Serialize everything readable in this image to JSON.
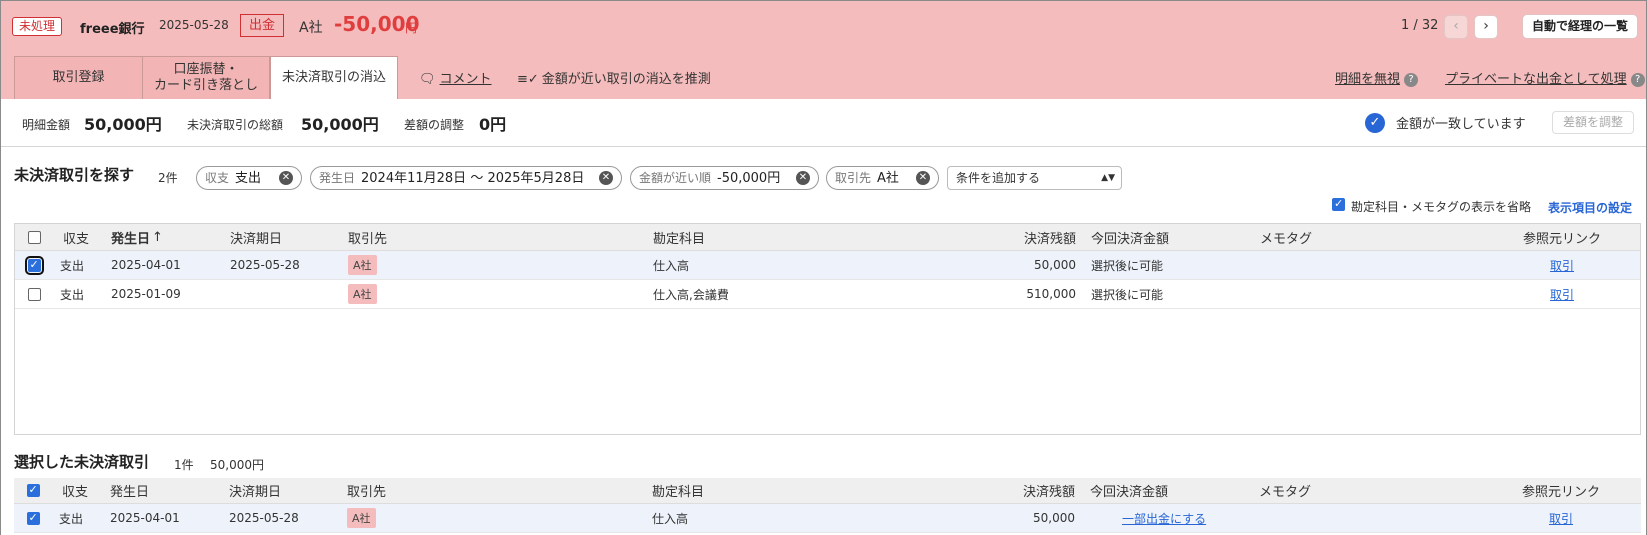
{
  "header": {
    "status_badge": "未処理",
    "bank": "freee銀行",
    "date": "2025-05-28",
    "type_badge": "出金",
    "partner": "A社",
    "amount": "-50,000",
    "amount_unit": "円",
    "pager": "1 / 32",
    "auto_button": "自動で経理の一覧",
    "accent": "#f4bcbc"
  },
  "tabs": [
    {
      "label": "取引登録"
    },
    {
      "label": "口座振替・\nカード引き落とし"
    },
    {
      "label": "未決済取引の消込"
    }
  ],
  "header_links": {
    "comment": "コメント",
    "suggest": "金額が近い取引の消込を推測",
    "ignore": "明細を無視",
    "private": "プライベートな出金として処理"
  },
  "summary": {
    "detail_label": "明細金額",
    "detail_value": "50,000円",
    "total_label": "未決済取引の総額",
    "total_value": "50,000円",
    "diff_label": "差額の調整",
    "diff_value": "0円",
    "match_text": "金額が一致しています",
    "adjust_button": "差額を調整"
  },
  "search": {
    "title": "未決済取引を探す",
    "count": "2件",
    "chips": [
      {
        "key": "収支",
        "value": "支出"
      },
      {
        "key": "発生日",
        "value": "2024年11月28日 〜 2025年5月28日"
      },
      {
        "key": "金額が近い順",
        "value": "-50,000円"
      },
      {
        "key": "取引先",
        "value": "A社"
      }
    ],
    "add_condition": "条件を追加する",
    "omit_label": "勘定科目・メモタグの表示を省略",
    "display_settings": "表示項目の設定"
  },
  "columns": {
    "type": "収支",
    "occurred": "発生日",
    "sort_indicator": "↑",
    "due": "決済期日",
    "partner": "取引先",
    "account": "勘定科目",
    "balance": "決済残額",
    "current": "今回決済金額",
    "memo": "メモタグ",
    "ref": "参照元リンク"
  },
  "rows": [
    {
      "type": "支出",
      "occurred": "2025-04-01",
      "due": "2025-05-28",
      "partner": "A社",
      "account": "仕入高",
      "balance": "50,000",
      "current": "選択後に可能",
      "ref": "取引"
    },
    {
      "type": "支出",
      "occurred": "2025-01-09",
      "due": "",
      "partner": "A社",
      "account": "仕入高,会議費",
      "balance": "510,000",
      "current": "選択後に可能",
      "ref": "取引"
    }
  ],
  "selected": {
    "title": "選択した未決済取引",
    "count": "1件",
    "amount": "50,000円",
    "rows": [
      {
        "type": "支出",
        "occurred": "2025-04-01",
        "due": "2025-05-28",
        "partner": "A社",
        "account": "仕入高",
        "balance": "50,000",
        "current": "一部出金にする",
        "ref": "取引"
      }
    ]
  }
}
